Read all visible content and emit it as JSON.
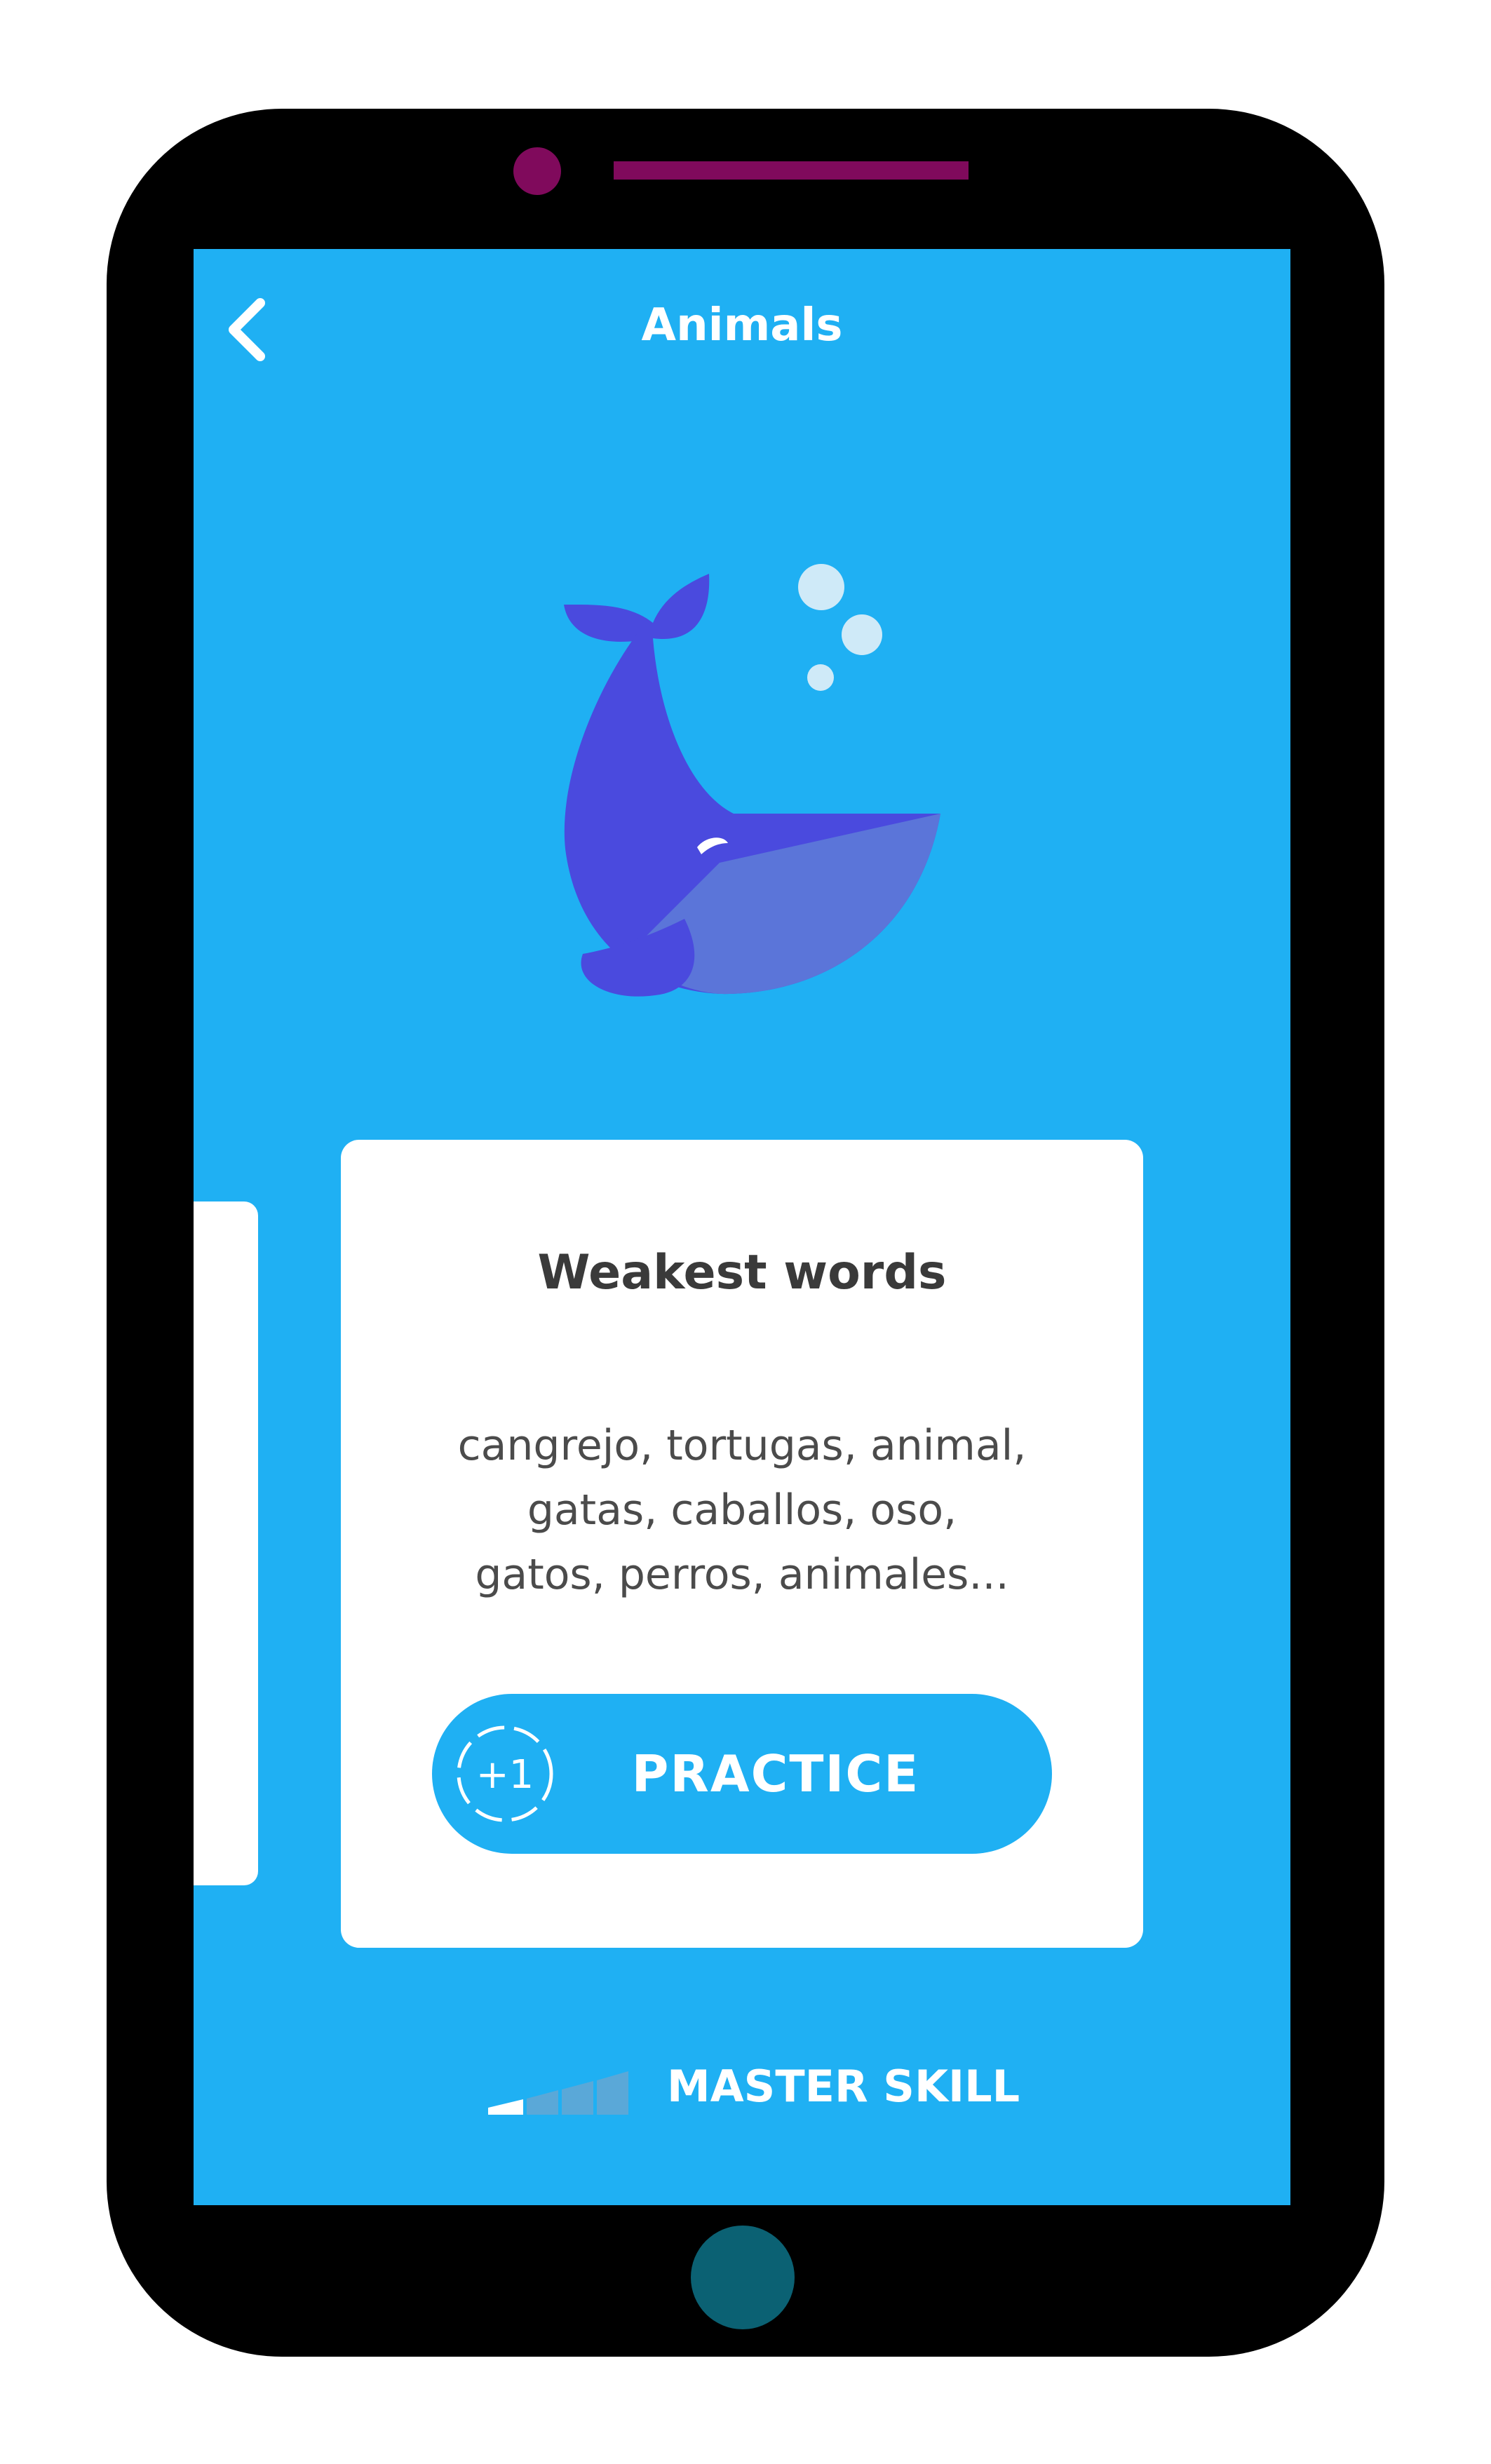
{
  "header": {
    "title": "Animals",
    "back_icon": "chevron-left-icon"
  },
  "illustration": {
    "name": "whale-illustration"
  },
  "card": {
    "title": "Weakest words",
    "words_lines": [
      "cangrejo, tortugas, animal,",
      "gatas, caballos, oso,",
      "gatos, perros, animales..."
    ],
    "practice_button": {
      "badge": "+1",
      "label": "PRACTICE"
    }
  },
  "footer": {
    "master_skill_label": "MASTER SKILL",
    "strength_icon": "strength-bars-icon"
  },
  "colors": {
    "screen_background": "#1fb0f3",
    "phone_frame": "#000000",
    "camera_and_speaker": "#800a5c",
    "home_button": "#0b6173",
    "whale_body": "#4a4ade",
    "card_background": "#ffffff"
  }
}
